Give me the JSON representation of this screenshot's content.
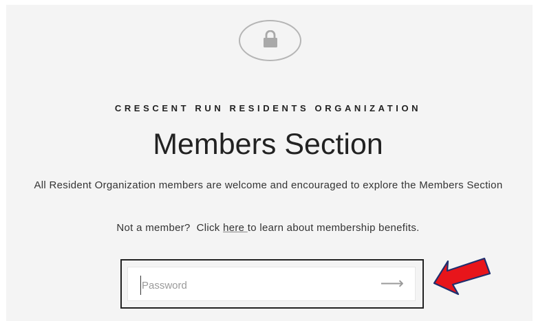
{
  "header": {
    "org_name": "CRESCENT RUN RESIDENTS ORGANIZATION",
    "title": "Members Section",
    "lock_icon": "lock-icon"
  },
  "intro": {
    "welcome_text": "All Resident Organization members are welcome and encouraged to explore the Members Section",
    "not_member_prefix": "Not a member?  Click ",
    "here_link": "here ",
    "not_member_suffix": "to learn about membership benefits."
  },
  "login": {
    "password_placeholder": "Password",
    "password_value": "",
    "submit_icon": "arrow-right-icon",
    "submit_glyph": "⟶"
  },
  "annotation": {
    "pointer_icon": "red-arrow-icon",
    "color": "#e8151b"
  }
}
